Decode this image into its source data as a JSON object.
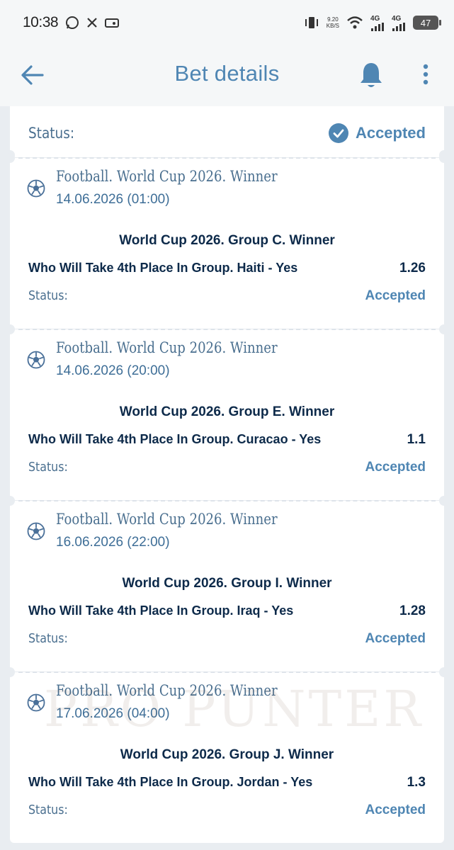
{
  "status_bar": {
    "time": "10:38",
    "speed_value": "9.20",
    "speed_unit": "KB/S",
    "network_1": "4G",
    "network_2": "4G",
    "battery": "47"
  },
  "header": {
    "title": "Bet details",
    "back_icon": "arrow-left-icon",
    "bell_icon": "bell-icon",
    "more_icon": "more-vertical-icon"
  },
  "summary": {
    "status_label": "Status:",
    "status_value": "Accepted"
  },
  "bets": [
    {
      "league": "Football. World Cup 2026. Winner",
      "datetime": "14.06.2026 (01:00)",
      "market": "World Cup 2026. Group C. Winner",
      "selection": "Who Will Take 4th Place In Group. Haiti - Yes",
      "odds": "1.26",
      "status_label": "Status:",
      "status_value": "Accepted"
    },
    {
      "league": "Football. World Cup 2026. Winner",
      "datetime": "14.06.2026 (20:00)",
      "market": "World Cup 2026. Group E. Winner",
      "selection": "Who Will Take 4th Place In Group. Curacao - Yes",
      "odds": "1.1",
      "status_label": "Status:",
      "status_value": "Accepted"
    },
    {
      "league": "Football. World Cup 2026. Winner",
      "datetime": "16.06.2026 (22:00)",
      "market": "World Cup 2026. Group I. Winner",
      "selection": "Who Will Take 4th Place In Group. Iraq - Yes",
      "odds": "1.28",
      "status_label": "Status:",
      "status_value": "Accepted"
    },
    {
      "league": "Football. World Cup 2026. Winner",
      "datetime": "17.06.2026 (04:00)",
      "market": "World Cup 2026. Group J. Winner",
      "selection": "Who Will Take 4th Place In Group. Jordan - Yes",
      "odds": "1.3",
      "status_label": "Status:",
      "status_value": "Accepted"
    }
  ],
  "watermark": "PRO PUNTER",
  "colors": {
    "accent": "#4f86b3",
    "text_dark": "#0d2a4a",
    "background": "#e9edf1"
  }
}
